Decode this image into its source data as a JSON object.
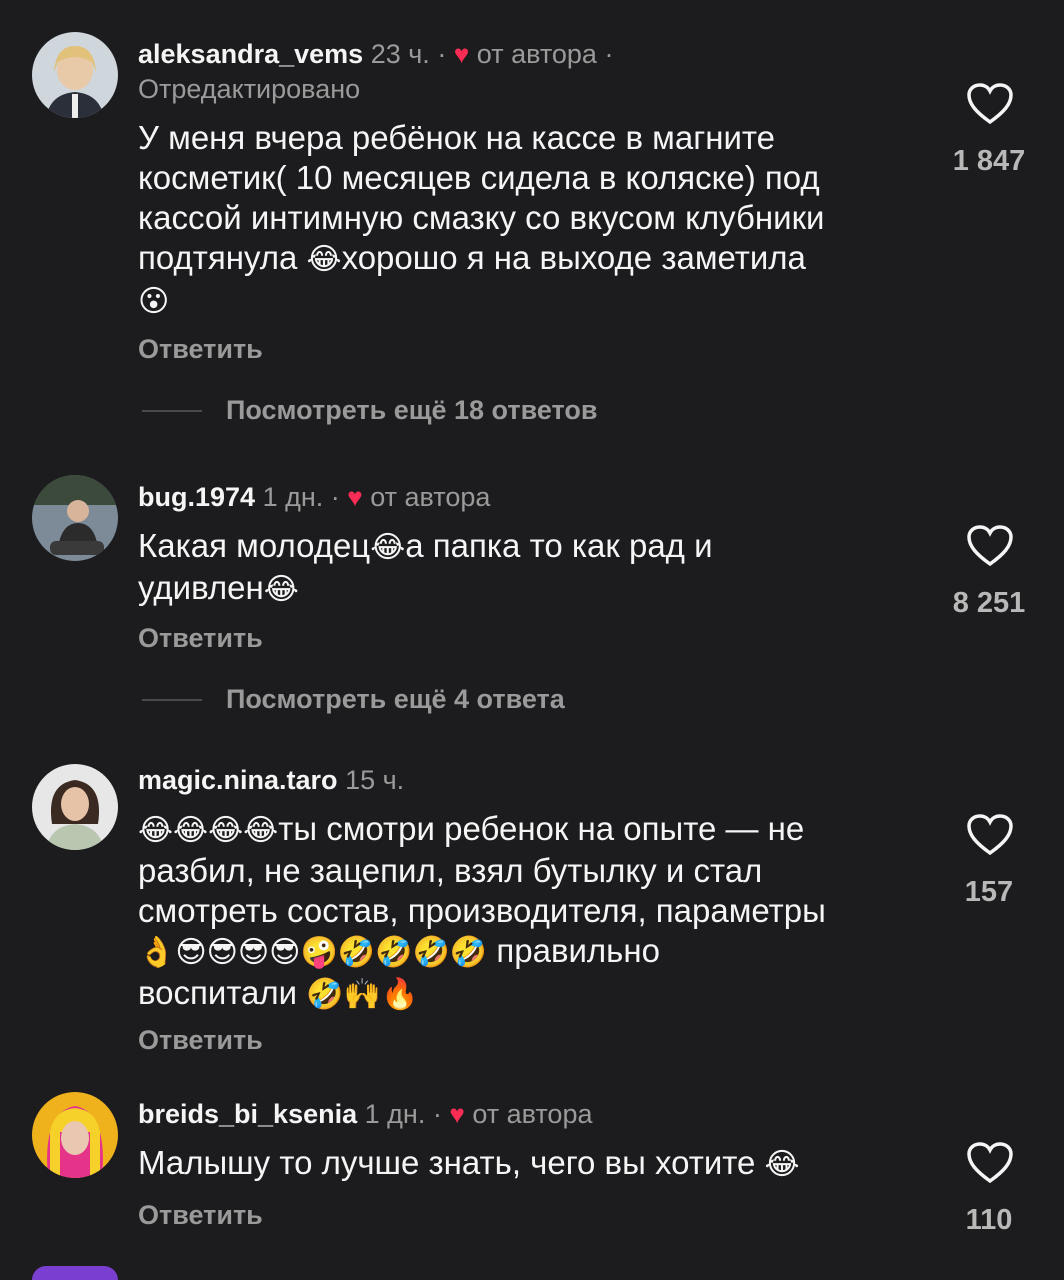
{
  "comments": [
    {
      "username": "aleksandra_vems",
      "time": "23 ч.",
      "author_like": "от автора",
      "edited": "Отредактировано",
      "text_l1": "У меня вчера ребёнок на кассе в магните",
      "text_l2": "косметик( 10 месяцев сидела в коляске) под",
      "text_l3": "кассой интимную смазку со вкусом клубники",
      "text_l4a": "подтянула ",
      "text_l4_emoji": "😂",
      "text_l4b": "хорошо я на выходе заметила",
      "text_l5_emoji": "😮",
      "reply": "Ответить",
      "more_replies": "Посмотреть ещё 18 ответов",
      "likes": "1 847"
    },
    {
      "username": "bug.1974",
      "time": "1 дн.",
      "author_like": "от автора",
      "text_l1a": "Какая молодец",
      "text_l1_emoji": "😂",
      "text_l1b": "а папка то как рад и",
      "text_l2a": "удивлен",
      "text_l2_emoji": "😂",
      "reply": "Ответить",
      "more_replies": "Посмотреть ещё 4 ответа",
      "likes": "8 251"
    },
    {
      "username": "magic.nina.taro",
      "time": "15 ч.",
      "text_l1_emoji": "😂😂😂😂",
      "text_l1": "ты смотри ребенок на опыте — не",
      "text_l2": "разбил, не зацепил, взял бутылку и стал",
      "text_l3": "смотреть состав, производителя, параметры",
      "text_l4_emoji": "👌😎😎😎😎🤪🤣🤣🤣🤣",
      "text_l4": " правильно",
      "text_l5": "воспитали ",
      "text_l5_emoji": "🤣🙌🔥",
      "reply": "Ответить",
      "likes": "157"
    },
    {
      "username": "breids_bi_ksenia",
      "time": "1 дн.",
      "author_like": "от автора",
      "text_l1": "Малышу то лучше знать, чего вы хотите ",
      "text_l1_emoji": "😂",
      "reply": "Ответить",
      "likes": "110"
    }
  ],
  "colors": {
    "background": "#1c1c1e",
    "author_heart": "#ff2d55",
    "secondary_text": "#9a9a9a"
  },
  "icons": [
    "heart-outline-icon",
    "heart-filled-icon",
    "avatar"
  ]
}
